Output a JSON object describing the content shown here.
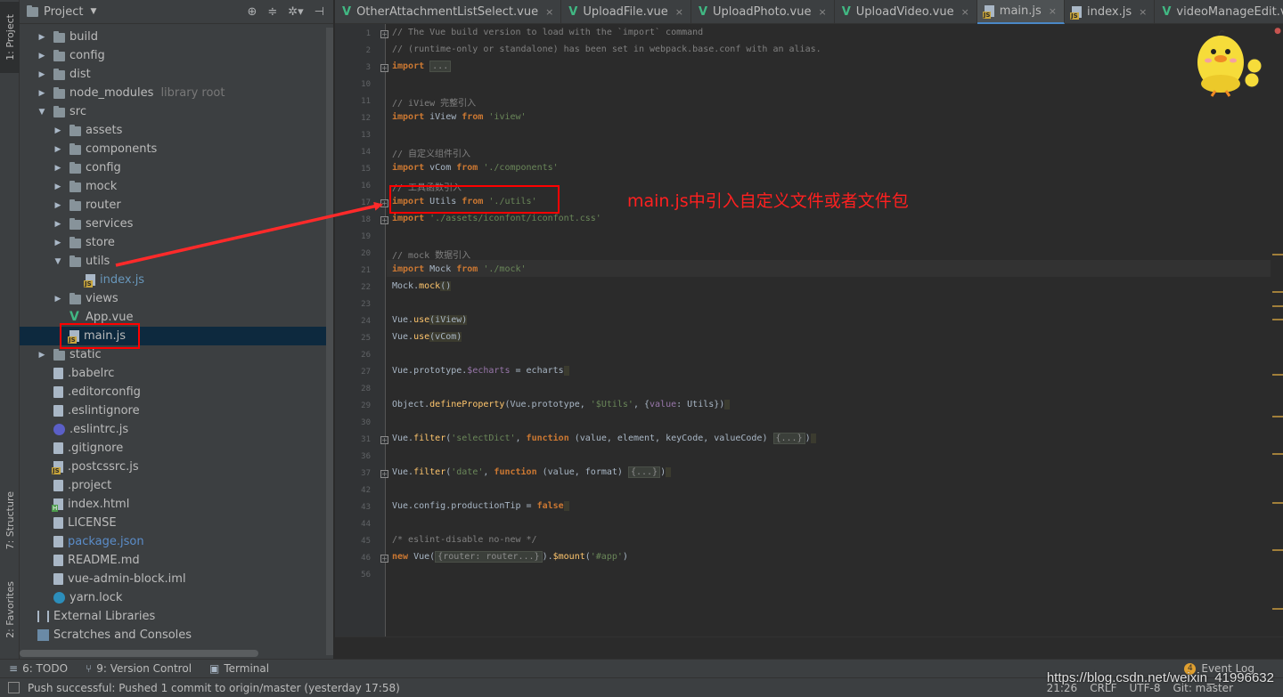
{
  "left_stripe": {
    "project_tab": "1: Project",
    "structure_tab": "7: Structure",
    "favorites_tab": "2: Favorites"
  },
  "project_panel": {
    "title": "Project",
    "tree": [
      {
        "label": "build",
        "type": "folder",
        "depth": 1,
        "arrow": "collapsed"
      },
      {
        "label": "config",
        "type": "folder",
        "depth": 1,
        "arrow": "collapsed"
      },
      {
        "label": "dist",
        "type": "folder",
        "depth": 1,
        "arrow": "collapsed"
      },
      {
        "label": "node_modules",
        "type": "folder",
        "depth": 1,
        "arrow": "collapsed",
        "suffix": "library root"
      },
      {
        "label": "src",
        "type": "folder",
        "depth": 1,
        "arrow": "expanded"
      },
      {
        "label": "assets",
        "type": "folder",
        "depth": 2,
        "arrow": "collapsed"
      },
      {
        "label": "components",
        "type": "folder",
        "depth": 2,
        "arrow": "collapsed"
      },
      {
        "label": "config",
        "type": "folder",
        "depth": 2,
        "arrow": "collapsed"
      },
      {
        "label": "mock",
        "type": "folder",
        "depth": 2,
        "arrow": "collapsed"
      },
      {
        "label": "router",
        "type": "folder",
        "depth": 2,
        "arrow": "collapsed"
      },
      {
        "label": "services",
        "type": "folder",
        "depth": 2,
        "arrow": "collapsed"
      },
      {
        "label": "store",
        "type": "folder",
        "depth": 2,
        "arrow": "collapsed"
      },
      {
        "label": "utils",
        "type": "folder",
        "depth": 2,
        "arrow": "expanded"
      },
      {
        "label": "index.js",
        "type": "js",
        "depth": 3,
        "arrow": "none",
        "style": "blue"
      },
      {
        "label": "views",
        "type": "folder",
        "depth": 2,
        "arrow": "collapsed"
      },
      {
        "label": "App.vue",
        "type": "vue",
        "depth": 2,
        "arrow": "none"
      },
      {
        "label": "main.js",
        "type": "js",
        "depth": 2,
        "arrow": "none",
        "selected": true
      },
      {
        "label": "static",
        "type": "folder",
        "depth": 1,
        "arrow": "collapsed"
      },
      {
        "label": ".babelrc",
        "type": "file",
        "depth": 1,
        "arrow": "none"
      },
      {
        "label": ".editorconfig",
        "type": "file",
        "depth": 1,
        "arrow": "none"
      },
      {
        "label": ".eslintignore",
        "type": "file",
        "depth": 1,
        "arrow": "none"
      },
      {
        "label": ".eslintrc.js",
        "type": "eslint",
        "depth": 1,
        "arrow": "none"
      },
      {
        "label": ".gitignore",
        "type": "file",
        "depth": 1,
        "arrow": "none"
      },
      {
        "label": ".postcssrc.js",
        "type": "js",
        "depth": 1,
        "arrow": "none"
      },
      {
        "label": ".project",
        "type": "file",
        "depth": 1,
        "arrow": "none"
      },
      {
        "label": "index.html",
        "type": "html",
        "depth": 1,
        "arrow": "none"
      },
      {
        "label": "LICENSE",
        "type": "file",
        "depth": 1,
        "arrow": "none"
      },
      {
        "label": "package.json",
        "type": "file",
        "depth": 1,
        "arrow": "none",
        "style": "link"
      },
      {
        "label": "README.md",
        "type": "file",
        "depth": 1,
        "arrow": "none"
      },
      {
        "label": "vue-admin-block.iml",
        "type": "file",
        "depth": 1,
        "arrow": "none"
      },
      {
        "label": "yarn.lock",
        "type": "yarn",
        "depth": 1,
        "arrow": "none"
      },
      {
        "label": "External Libraries",
        "type": "lib",
        "depth": 0,
        "arrow": "none"
      },
      {
        "label": "Scratches and Consoles",
        "type": "scratch",
        "depth": 0,
        "arrow": "none"
      }
    ]
  },
  "editor_tabs": [
    {
      "label": "OtherAttachmentListSelect.vue",
      "icon": "vue"
    },
    {
      "label": "UploadFile.vue",
      "icon": "vue"
    },
    {
      "label": "UploadPhoto.vue",
      "icon": "vue"
    },
    {
      "label": "UploadVideo.vue",
      "icon": "vue"
    },
    {
      "label": "main.js",
      "icon": "js",
      "active": true
    },
    {
      "label": "index.js",
      "icon": "js"
    },
    {
      "label": "videoManageEdit.vu",
      "icon": "vue"
    }
  ],
  "code": {
    "line_numbers": [
      "1",
      "2",
      "3",
      "10",
      "11",
      "12",
      "13",
      "14",
      "15",
      "16",
      "17",
      "18",
      "19",
      "20",
      "21",
      "22",
      "23",
      "24",
      "25",
      "26",
      "27",
      "28",
      "29",
      "30",
      "31",
      "36",
      "37",
      "42",
      "43",
      "44",
      "45",
      "46",
      "56"
    ],
    "lines": [
      [
        {
          "t": "// The Vue build version to load with the `import` command",
          "c": "cm"
        }
      ],
      [
        {
          "t": "// (runtime-only or standalone) has been set in webpack.base.conf with an alias.",
          "c": "cm"
        }
      ],
      [
        {
          "t": "import",
          "c": "kw"
        },
        {
          "t": " "
        },
        {
          "t": "...",
          "c": "folded"
        }
      ],
      [],
      [
        {
          "t": "// iView 完整引入",
          "c": "cm"
        }
      ],
      [
        {
          "t": "import",
          "c": "kw"
        },
        {
          "t": " iView "
        },
        {
          "t": "from",
          "c": "kw"
        },
        {
          "t": " "
        },
        {
          "t": "'iview'",
          "c": "str"
        }
      ],
      [],
      [
        {
          "t": "// 自定义组件引入",
          "c": "cm"
        }
      ],
      [
        {
          "t": "import",
          "c": "kw"
        },
        {
          "t": " vCom "
        },
        {
          "t": "from",
          "c": "kw"
        },
        {
          "t": " "
        },
        {
          "t": "'./components'",
          "c": "str"
        }
      ],
      [
        {
          "t": "// 工具函数引入",
          "c": "cm"
        }
      ],
      [
        {
          "t": "import",
          "c": "kw"
        },
        {
          "t": " Utils "
        },
        {
          "t": "from",
          "c": "kw"
        },
        {
          "t": " "
        },
        {
          "t": "'./utils'",
          "c": "str"
        }
      ],
      [
        {
          "t": "import",
          "c": "kw"
        },
        {
          "t": " "
        },
        {
          "t": "'./assets/iconfont/iconfont.css'",
          "c": "str"
        }
      ],
      [],
      [
        {
          "t": "// mock 数据引入",
          "c": "cm"
        }
      ],
      [
        {
          "t": "import",
          "c": "kw"
        },
        {
          "t": " Mock "
        },
        {
          "t": "from",
          "c": "kw"
        },
        {
          "t": " "
        },
        {
          "t": "'./mock'",
          "c": "str"
        }
      ],
      [
        {
          "t": "Mock."
        },
        {
          "t": "mock",
          "c": "fn"
        },
        {
          "t": "()",
          "c": "mbr"
        }
      ],
      [],
      [
        {
          "t": "Vue."
        },
        {
          "t": "use",
          "c": "fn"
        },
        {
          "t": "(iView)",
          "c": "mbr"
        }
      ],
      [
        {
          "t": "Vue."
        },
        {
          "t": "use",
          "c": "fn"
        },
        {
          "t": "(vCom)",
          "c": "mbr"
        }
      ],
      [],
      [
        {
          "t": "Vue.prototype."
        },
        {
          "t": "$echarts",
          "c": "prop"
        },
        {
          "t": " = echarts"
        },
        {
          "t": " ",
          "c": "mbr"
        }
      ],
      [],
      [
        {
          "t": "Object."
        },
        {
          "t": "defineProperty",
          "c": "fn"
        },
        {
          "t": "(Vue.prototype, "
        },
        {
          "t": "'$Utils'",
          "c": "str"
        },
        {
          "t": ", {"
        },
        {
          "t": "value",
          "c": "prop"
        },
        {
          "t": ": Utils})"
        },
        {
          "t": " ",
          "c": "mbr"
        }
      ],
      [],
      [
        {
          "t": "Vue."
        },
        {
          "t": "filter",
          "c": "fn"
        },
        {
          "t": "("
        },
        {
          "t": "'selectDict'",
          "c": "str"
        },
        {
          "t": ", "
        },
        {
          "t": "function",
          "c": "kw"
        },
        {
          "t": " (value, element, keyCode, valueCode) "
        },
        {
          "t": "{...}",
          "c": "folded"
        },
        {
          "t": ")"
        },
        {
          "t": " ",
          "c": "mbr"
        }
      ],
      [],
      [
        {
          "t": "Vue."
        },
        {
          "t": "filter",
          "c": "fn"
        },
        {
          "t": "("
        },
        {
          "t": "'date'",
          "c": "str"
        },
        {
          "t": ", "
        },
        {
          "t": "function",
          "c": "kw"
        },
        {
          "t": " (value, format) "
        },
        {
          "t": "{...}",
          "c": "folded"
        },
        {
          "t": ")"
        },
        {
          "t": " ",
          "c": "mbr"
        }
      ],
      [],
      [
        {
          "t": "Vue.config.productionTip = "
        },
        {
          "t": "false",
          "c": "kw"
        },
        {
          "t": " ",
          "c": "mbr"
        }
      ],
      [],
      [
        {
          "t": "/* eslint-disable no-new */",
          "c": "cm"
        }
      ],
      [
        {
          "t": "new",
          "c": "kw"
        },
        {
          "t": " Vue("
        },
        {
          "t": "{router: router...}",
          "c": "folded"
        },
        {
          "t": ")."
        },
        {
          "t": "$mount",
          "c": "fn"
        },
        {
          "t": "("
        },
        {
          "t": "'#app'",
          "c": "str"
        },
        {
          "t": ")"
        }
      ],
      []
    ]
  },
  "annotation": {
    "text": "main.js中引入自定义文件或者文件包",
    "color": "#ff2020"
  },
  "toolwindows": {
    "todo": "6: TODO",
    "vcs": "9: Version Control",
    "terminal": "Terminal",
    "event_log_count": "4",
    "event_log": "Event Log"
  },
  "status_bar": {
    "message": "Push successful: Pushed 1 commit to origin/master (yesterday 17:58)",
    "position": "21:26",
    "line_sep": "CRLF",
    "encoding": "UTF-8",
    "git": "Git: master"
  },
  "watermark": "https://blog.csdn.net/weixin_41996632"
}
